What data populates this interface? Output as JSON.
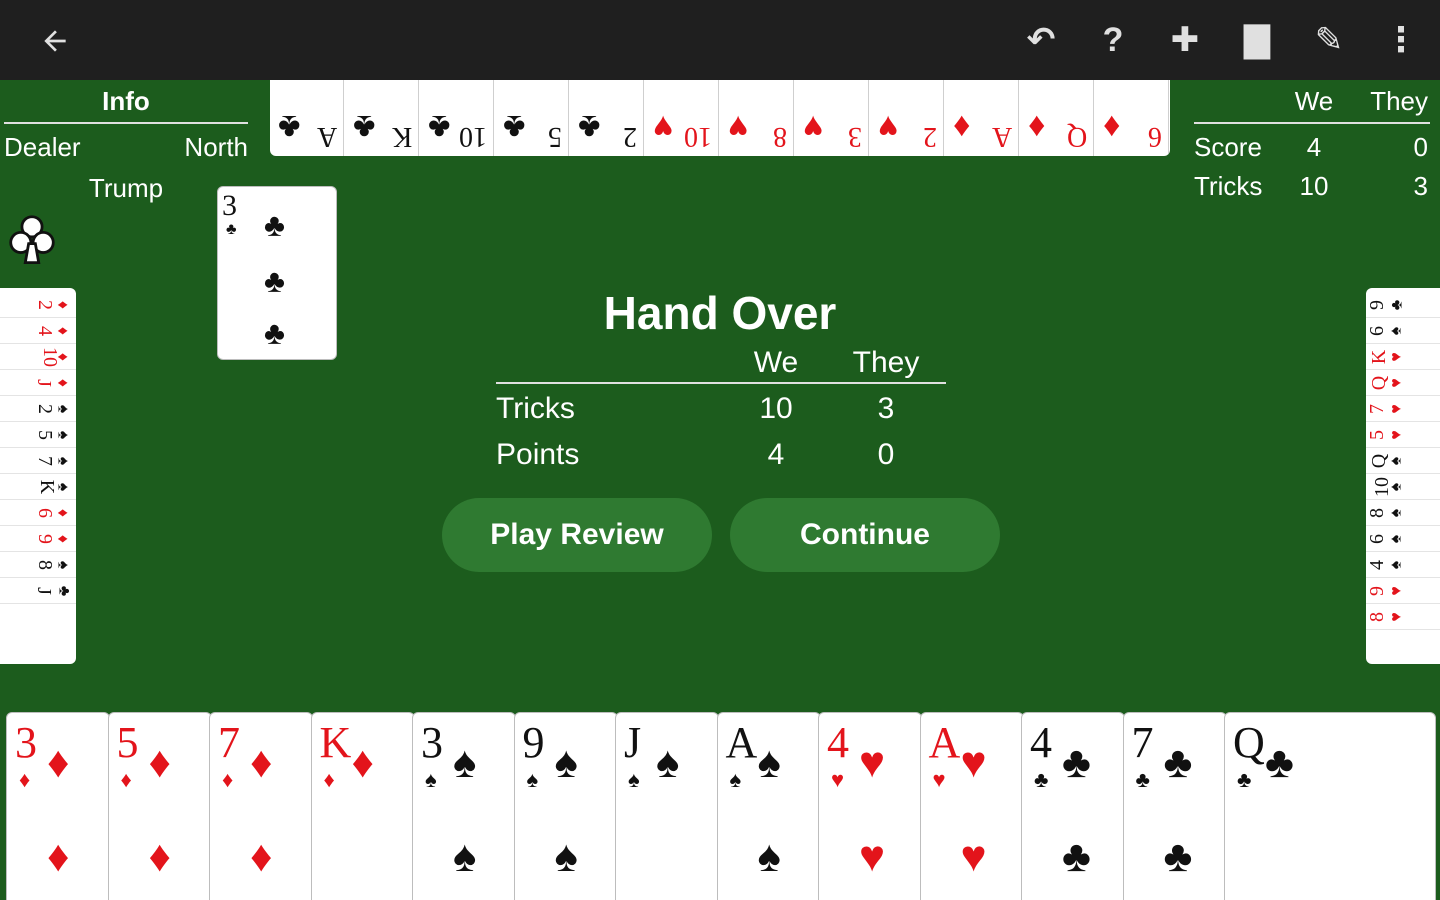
{
  "toolbar": {
    "back_icon": "arrow-back-icon",
    "actions": [
      {
        "icon": "undo-icon",
        "glyph": "↶"
      },
      {
        "icon": "help-icon",
        "glyph": "?"
      },
      {
        "icon": "gamepad-icon",
        "glyph": "✚"
      },
      {
        "icon": "card-deck-icon",
        "glyph": "▇"
      },
      {
        "icon": "scoresheet-icon",
        "glyph": "✎"
      },
      {
        "icon": "more-vert-icon",
        "glyph": "⋮"
      }
    ]
  },
  "info": {
    "title": "Info",
    "dealer_label": "Dealer",
    "dealer_value": "North",
    "trump_label": "Trump",
    "trump_suit": "clubs"
  },
  "scoreboard": {
    "col_we": "We",
    "col_they": "They",
    "rows": [
      {
        "label": "Score",
        "we": "4",
        "they": "0"
      },
      {
        "label": "Tricks",
        "we": "10",
        "they": "3"
      }
    ]
  },
  "table_card": {
    "rank": "3",
    "suit": "♣"
  },
  "dialog": {
    "title": "Hand Over",
    "col_we": "We",
    "col_they": "They",
    "rows": [
      {
        "label": "Tricks",
        "we": "10",
        "they": "3"
      },
      {
        "label": "Points",
        "we": "4",
        "they": "0"
      }
    ],
    "play_review_label": "Play Review",
    "continue_label": "Continue"
  },
  "north_hand": [
    {
      "rank": "A",
      "suit": "♣",
      "color": "black"
    },
    {
      "rank": "K",
      "suit": "♣",
      "color": "black"
    },
    {
      "rank": "10",
      "suit": "♣",
      "color": "black"
    },
    {
      "rank": "5",
      "suit": "♣",
      "color": "black"
    },
    {
      "rank": "2",
      "suit": "♣",
      "color": "black"
    },
    {
      "rank": "10",
      "suit": "♥",
      "color": "red"
    },
    {
      "rank": "8",
      "suit": "♥",
      "color": "red"
    },
    {
      "rank": "3",
      "suit": "♥",
      "color": "red"
    },
    {
      "rank": "2",
      "suit": "♥",
      "color": "red"
    },
    {
      "rank": "A",
      "suit": "♦",
      "color": "red"
    },
    {
      "rank": "Q",
      "suit": "♦",
      "color": "red"
    },
    {
      "rank": "6",
      "suit": "♦",
      "color": "red"
    }
  ],
  "west_hand": [
    {
      "rank": "2",
      "suit": "♦",
      "color": "red"
    },
    {
      "rank": "4",
      "suit": "♦",
      "color": "red"
    },
    {
      "rank": "10",
      "suit": "♦",
      "color": "red"
    },
    {
      "rank": "J",
      "suit": "♦",
      "color": "red"
    },
    {
      "rank": "2",
      "suit": "♠",
      "color": "black"
    },
    {
      "rank": "5",
      "suit": "♠",
      "color": "black"
    },
    {
      "rank": "7",
      "suit": "♠",
      "color": "black"
    },
    {
      "rank": "K",
      "suit": "♠",
      "color": "black"
    },
    {
      "rank": "6",
      "suit": "♦",
      "color": "red"
    },
    {
      "rank": "9",
      "suit": "♦",
      "color": "red"
    },
    {
      "rank": "8",
      "suit": "♠",
      "color": "black"
    },
    {
      "rank": "J",
      "suit": "♣",
      "color": "black"
    }
  ],
  "east_hand": [
    {
      "rank": "9",
      "suit": "♣",
      "color": "black"
    },
    {
      "rank": "6",
      "suit": "♠",
      "color": "black"
    },
    {
      "rank": "K",
      "suit": "♥",
      "color": "red"
    },
    {
      "rank": "Q",
      "suit": "♥",
      "color": "red"
    },
    {
      "rank": "7",
      "suit": "♥",
      "color": "red"
    },
    {
      "rank": "5",
      "suit": "♥",
      "color": "red"
    },
    {
      "rank": "Q",
      "suit": "♠",
      "color": "black"
    },
    {
      "rank": "10",
      "suit": "♠",
      "color": "black"
    },
    {
      "rank": "8",
      "suit": "♠",
      "color": "black"
    },
    {
      "rank": "6",
      "suit": "♠",
      "color": "black"
    },
    {
      "rank": "4",
      "suit": "♠",
      "color": "black"
    },
    {
      "rank": "9",
      "suit": "♥",
      "color": "red"
    },
    {
      "rank": "8",
      "suit": "♥",
      "color": "red"
    }
  ],
  "player_hand": [
    {
      "rank": "3",
      "suit": "♦",
      "color": "red"
    },
    {
      "rank": "5",
      "suit": "♦",
      "color": "red"
    },
    {
      "rank": "7",
      "suit": "♦",
      "color": "red"
    },
    {
      "rank": "K",
      "suit": "♦",
      "color": "red"
    },
    {
      "rank": "3",
      "suit": "♠",
      "color": "black"
    },
    {
      "rank": "9",
      "suit": "♠",
      "color": "black"
    },
    {
      "rank": "J",
      "suit": "♠",
      "color": "black"
    },
    {
      "rank": "A",
      "suit": "♠",
      "color": "black"
    },
    {
      "rank": "4",
      "suit": "♥",
      "color": "red"
    },
    {
      "rank": "A",
      "suit": "♥",
      "color": "red"
    },
    {
      "rank": "4",
      "suit": "♣",
      "color": "black"
    },
    {
      "rank": "7",
      "suit": "♣",
      "color": "black"
    },
    {
      "rank": "Q",
      "suit": "♣",
      "color": "black"
    }
  ],
  "colors": {
    "felt": "#1c5c1d",
    "toolbar": "#1f1f1f",
    "button": "#2f7a31",
    "red_suit": "#e3141b"
  }
}
